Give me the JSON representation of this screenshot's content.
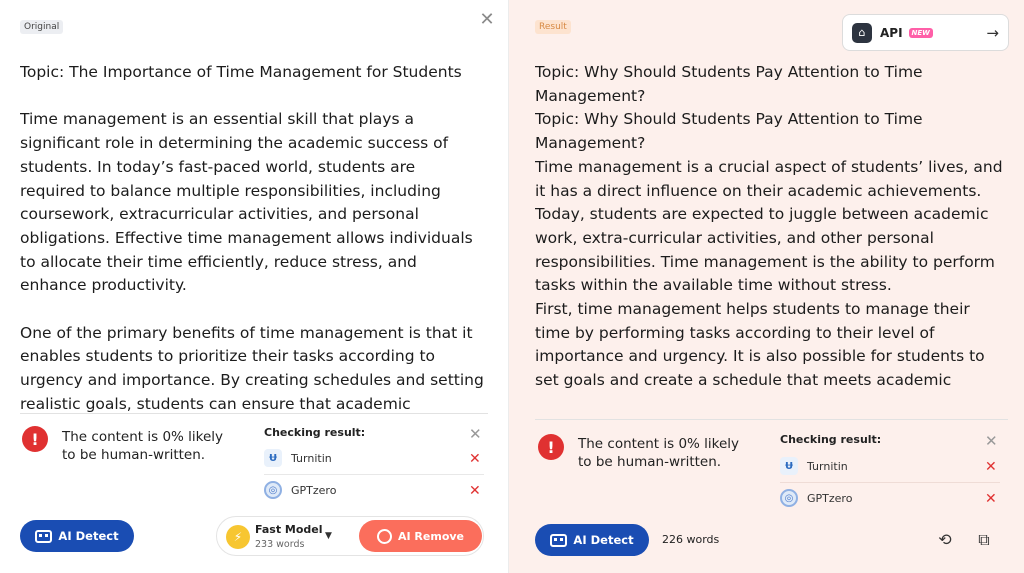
{
  "original": {
    "tag": "Original",
    "topic": "Topic: The Importance of Time Management for Students",
    "paragraph1": "Time management is an essential skill that plays a significant role in determining the academic success of students. In today’s fast-paced world, students are required to balance multiple responsibilities, including coursework, extracurricular activities, and personal obligations. Effective time management allows individuals to allocate their time efficiently, reduce stress, and enhance productivity.",
    "paragraph2": "One of the primary benefits of time management is that it enables students to prioritize their tasks according to urgency and importance. By creating schedules and setting realistic goals, students can ensure that academic",
    "detection_text": "The content is 0% likely to be human-written.",
    "checking_title": "Checking result:",
    "detectors": [
      {
        "name": "Turnitin",
        "icon": "turnitin-icon"
      },
      {
        "name": "GPTzero",
        "icon": "gptzero-icon"
      }
    ],
    "detect_button": "AI Detect",
    "model_name": "Fast Model",
    "model_words": "233 words",
    "remove_button": "AI Remove"
  },
  "result": {
    "tag": "Result",
    "api_label": "API",
    "api_badge": "NEW",
    "line1": "Topic: Why Should Students Pay Attention to Time Management?",
    "line2": "Topic: Why Should Students Pay Attention to Time Management?",
    "paragraph1": "Time management is a crucial aspect of students’ lives, and it has a direct influence on their academic achievements. Today, students are expected to juggle between academic work, extra-curricular activities, and other personal responsibilities. Time management is the ability to perform tasks within the available time without stress.",
    "paragraph2": "First, time management helps students to manage their time by performing tasks according to their level of importance and urgency. It is also possible for students to set goals and create a schedule that meets academic",
    "detection_text": "The content is 0% likely to be human-written.",
    "checking_title": "Checking result:",
    "detectors": [
      {
        "name": "Turnitin",
        "icon": "turnitin-icon"
      },
      {
        "name": "GPTzero",
        "icon": "gptzero-icon"
      }
    ],
    "detect_button": "AI Detect",
    "word_count": "226 words"
  },
  "colors": {
    "detect_blue": "#1a4db3",
    "remove_coral": "#fb6e5c",
    "alert_red": "#e03131",
    "result_bg": "#fdf0ec"
  }
}
